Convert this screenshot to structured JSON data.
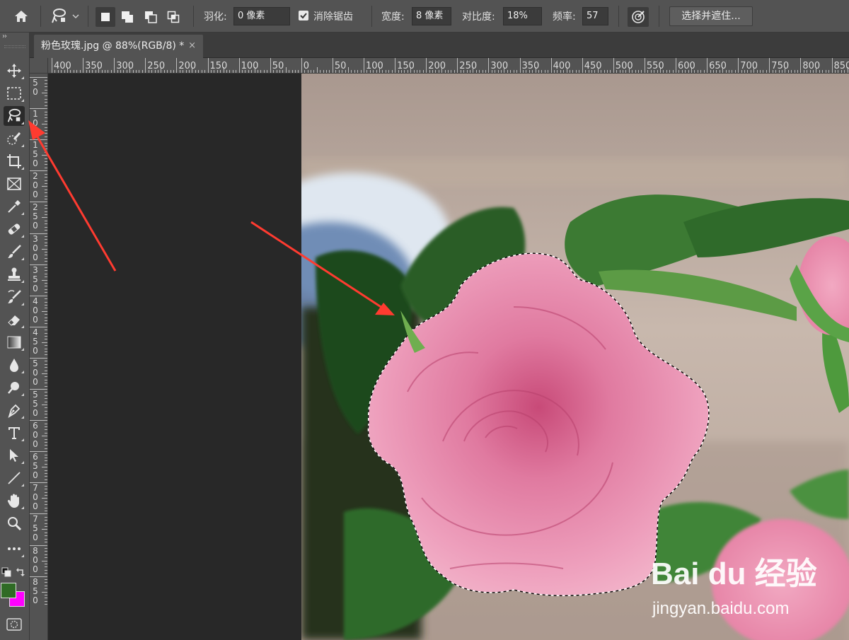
{
  "options_bar": {
    "feather_label": "羽化:",
    "feather_value": "0 像素",
    "antialias_label": "消除锯齿",
    "antialias_checked": true,
    "width_label": "宽度:",
    "width_value": "8 像素",
    "contrast_label": "对比度:",
    "contrast_value": "18%",
    "frequency_label": "频率:",
    "frequency_value": "57",
    "select_mask_label": "选择并遮住..."
  },
  "document_tab": {
    "title": "粉色玫瑰.jpg @ 88%(RGB/8) *",
    "close_glyph": "×"
  },
  "toolbox": {
    "collapse_glyph": "››",
    "foreground_color": "#2f6b25",
    "background_color": "#ff00ff",
    "tools": [
      {
        "name": "move-tool",
        "icon": "move-icon"
      },
      {
        "name": "marquee-tool",
        "icon": "rect-marquee-icon"
      },
      {
        "name": "magnetic-lasso-tool",
        "icon": "magnetic-lasso-icon",
        "active": true
      },
      {
        "name": "quick-selection-tool",
        "icon": "quick-select-icon"
      },
      {
        "name": "crop-tool",
        "icon": "crop-icon"
      },
      {
        "name": "frame-tool",
        "icon": "frame-icon"
      },
      {
        "name": "eyedropper-tool",
        "icon": "eyedropper-icon"
      },
      {
        "name": "healing-brush-tool",
        "icon": "bandage-icon"
      },
      {
        "name": "brush-tool",
        "icon": "brush-icon"
      },
      {
        "name": "clone-stamp-tool",
        "icon": "stamp-icon"
      },
      {
        "name": "history-brush-tool",
        "icon": "history-brush-icon"
      },
      {
        "name": "eraser-tool",
        "icon": "eraser-icon"
      },
      {
        "name": "gradient-tool",
        "icon": "gradient-icon"
      },
      {
        "name": "blur-tool",
        "icon": "droplet-icon"
      },
      {
        "name": "dodge-tool",
        "icon": "dodge-icon"
      },
      {
        "name": "pen-tool",
        "icon": "pen-icon"
      },
      {
        "name": "type-tool",
        "icon": "type-icon"
      },
      {
        "name": "path-selection-tool",
        "icon": "arrow-icon"
      },
      {
        "name": "line-tool",
        "icon": "line-icon"
      },
      {
        "name": "hand-tool",
        "icon": "hand-icon"
      },
      {
        "name": "zoom-tool",
        "icon": "zoom-icon"
      },
      {
        "name": "more-tools",
        "icon": "more-icon"
      }
    ]
  },
  "ruler_h": {
    "labels": [
      "400",
      "350",
      "300",
      "250",
      "200",
      "150",
      "100",
      "50",
      "0",
      "50",
      "100",
      "150",
      "200",
      "250",
      "300",
      "350",
      "400",
      "450",
      "500",
      "550",
      "600",
      "650",
      "700",
      "750",
      "800",
      "850"
    ]
  },
  "ruler_v": {
    "labels": [
      "50",
      "100",
      "150",
      "200",
      "250",
      "300",
      "350",
      "400",
      "450",
      "500",
      "550",
      "600",
      "650",
      "700",
      "750",
      "800",
      "850"
    ]
  },
  "watermark": {
    "logo_text": "Bai du 经验",
    "url": "jingyan.baidu.com"
  },
  "colors": {
    "annotation_arrow": "#ff3b30"
  }
}
